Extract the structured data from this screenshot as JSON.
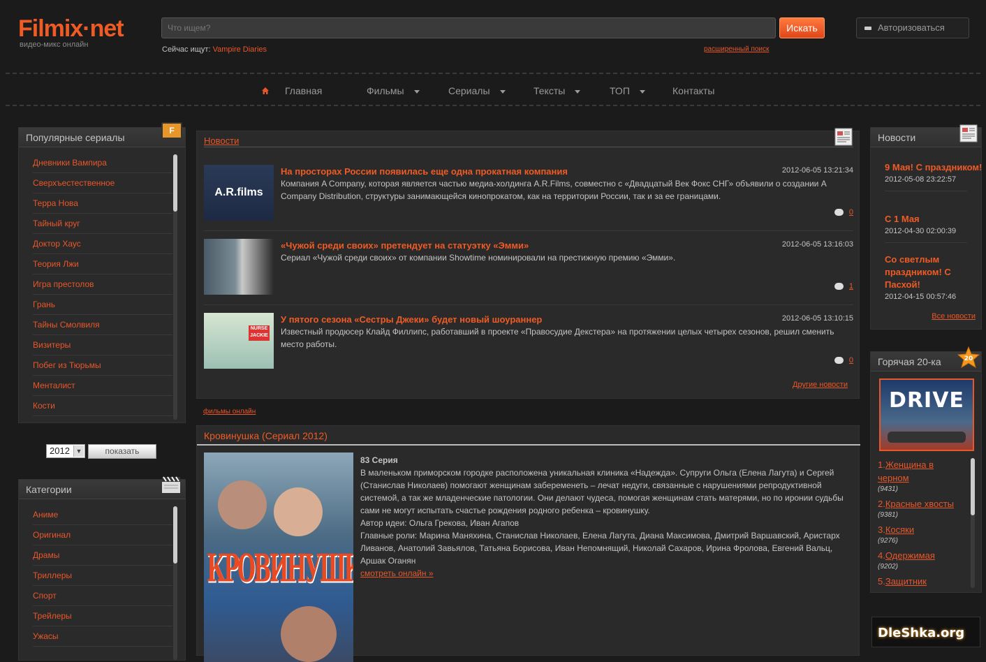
{
  "header": {
    "logo": "Filmix·net",
    "logo_sub": "видео-микс онлайн",
    "search_placeholder": "Что ищем?",
    "search_button": "Искать",
    "searching_label": "Сейчас ищут:",
    "searching_link": "Vampire Diaries",
    "advanced_search": "расширенный поиск",
    "login": "Авторизоваться"
  },
  "nav": {
    "items": [
      "Главная",
      "Фильмы",
      "Сериалы",
      "Тексты",
      "ТОП",
      "Контакты"
    ]
  },
  "popular": {
    "title": "Популярные сериалы",
    "items": [
      "Дневники Вампира",
      "Сверхъестественное",
      "Терра Нова",
      "Тайный круг",
      "Доктор Хаус",
      "Теория Лжи",
      "Игра престолов",
      "Грань",
      "Тайны Смолвиля",
      "Визитеры",
      "Побег из Тюрьмы",
      "Менталист",
      "Кости"
    ]
  },
  "year_filter": {
    "year": "2012",
    "button": "показать"
  },
  "categories": {
    "title": "Категории",
    "items": [
      "Аниме",
      "Оригинал",
      "Драмы",
      "Триллеры",
      "Спорт",
      "Трейлеры",
      "Ужасы"
    ]
  },
  "news": {
    "title": "Новости",
    "items": [
      {
        "thumb": "A.R.films",
        "title": "На просторах России появилась еще одна прокатная компания",
        "date": "2012-06-05 13:21:34",
        "text": "Компания A Company, которая является частью медиа-холдинга A.R.Films, совместно с «Двадцатый Век Фокс СНГ» объявили о создании A Company Distribution, структуры занимающейся кинопрокатом, как на территории России, так и за ее границами.",
        "comments": "0"
      },
      {
        "thumb": "",
        "title": "«Чужой среди своих» претендует на статуэтку «Эмми»",
        "date": "2012-06-05 13:16:03",
        "text": "Сериал «Чужой среди своих» от компании Showtime номинировали на престижную премию «Эмми».",
        "comments": "1"
      },
      {
        "thumb": "NURSE JACKIE",
        "title": "У пятого сезона «Сестры Джеки» будет новый шоураннер",
        "date": "2012-06-05 13:10:15",
        "text": "Известный продюсер Клайд Филлипс, работавший в проекте «Правосудие Декстера» на протяжении целых четырех сезонов, решил сменить место работы.",
        "comments": "0"
      }
    ],
    "more": "Другие новости"
  },
  "films_link": "фильмы онлайн",
  "feature": {
    "title": "Кровинушка (Сериал 2012)",
    "poster_text": "КРОВИНУШКА",
    "episode": "83 Серия",
    "desc": "В маленьком приморском городке расположена уникальная клиника «Надежда». Супруги Ольга (Елена Лагута) и Сергей (Станислав Николаев) помогают женщинам забеременеть – лечат недуги, связанные с нарушениями репродуктивной системой, а так же младенческие патологии. Они делают чудеса, помогая женщинам стать матерями, но по иронии судьбы сами не могут испытать счастье рождения родного ребенка – кровинушку.",
    "author": "Автор идеи: Ольга Грекова, Иван Агапов",
    "cast": "Главные роли: Марина Маняхина, Станислав Николаев, Елена Лагута, Диана Максимова, Дмитрий Варшавский, Аристарх Ливанов, Анатолий Завьялов, Татьяна Борисова, Иван Непомнящий, Николай Сахаров, Ирина Фролова, Евгений Вальц, Аршак Оганян",
    "watch": "смотреть онлайн »"
  },
  "side_news": {
    "title": "Новости",
    "items": [
      {
        "title": "9 Мая! С праздником!",
        "date": "2012-05-08 23:22:57"
      },
      {
        "title": "С 1 Мая",
        "date": "2012-04-30 02:00:39"
      },
      {
        "title": "Со светлым праздником! С Пасхой!",
        "date": "2012-04-15 00:57:46"
      }
    ],
    "all": "Все новости"
  },
  "hot": {
    "title": "Горячая 20-ка",
    "badge": "20",
    "poster_text": "DRIVE",
    "items": [
      {
        "num": "1.",
        "title": "Женщина в черном",
        "count": "(9431)"
      },
      {
        "num": "2.",
        "title": "Красные хвосты",
        "count": "(9381)"
      },
      {
        "num": "3.",
        "title": "Косяки",
        "count": "(9276)"
      },
      {
        "num": "4.",
        "title": "Одержимая",
        "count": "(9202)"
      },
      {
        "num": "5.",
        "title": "Защитник",
        "count": ""
      }
    ]
  },
  "watermark": "DleShka.org"
}
